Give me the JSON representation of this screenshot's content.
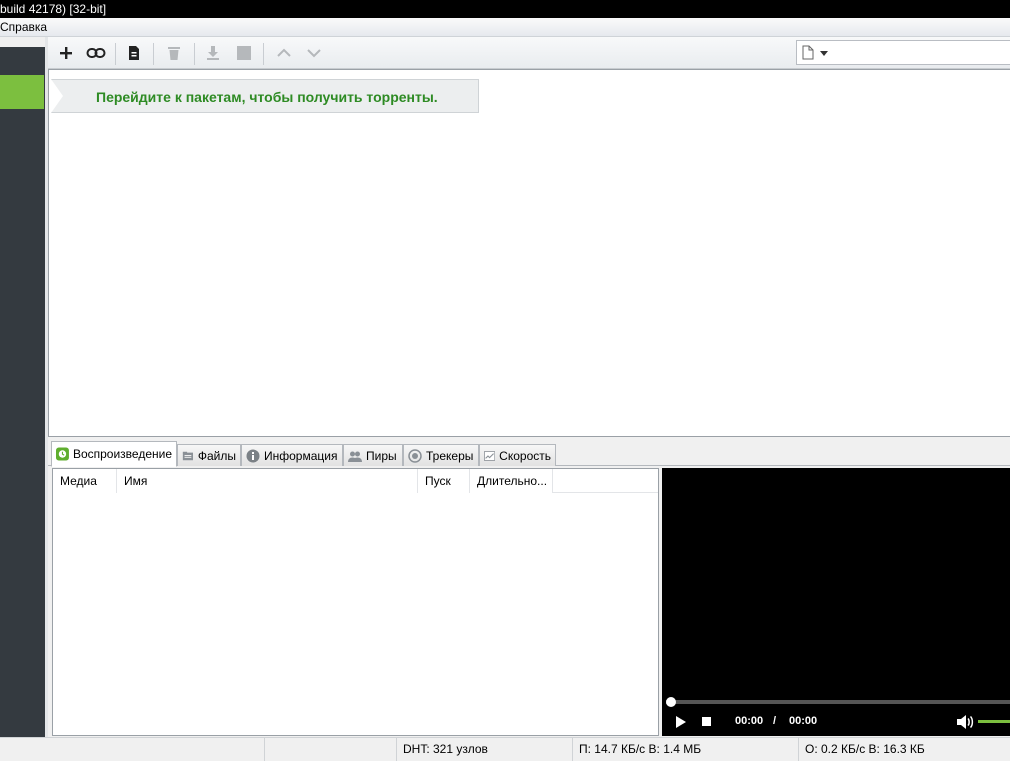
{
  "window": {
    "title": "build 42178) [32-bit]"
  },
  "menu": {
    "help": "Справка"
  },
  "toolbar": {
    "buttons": [
      {
        "icon": "plus-icon"
      },
      {
        "icon": "link-icon"
      },
      {
        "icon": "create-torrent-icon"
      },
      {
        "icon": "trash-icon"
      },
      {
        "icon": "download-icon"
      },
      {
        "icon": "stop-icon"
      },
      {
        "icon": "chevron-up-icon"
      },
      {
        "icon": "chevron-down-icon"
      }
    ]
  },
  "banner": {
    "text": "Перейдите к пакетам, чтобы получить торренты."
  },
  "tabs": [
    {
      "label": "Воспроизведение",
      "icon": "playback-icon",
      "active": true
    },
    {
      "label": "Файлы",
      "icon": "files-icon"
    },
    {
      "label": "Информация",
      "icon": "info-icon"
    },
    {
      "label": "Пиры",
      "icon": "peers-icon"
    },
    {
      "label": "Трекеры",
      "icon": "trackers-icon"
    },
    {
      "label": "Скорость",
      "icon": "speed-icon"
    }
  ],
  "columns": [
    "Медиа",
    "Имя",
    "Пуск",
    "Длительно..."
  ],
  "player": {
    "current": "00:00",
    "separator": "/",
    "total": "00:00"
  },
  "status": {
    "dht": "DHT: 321 узлов",
    "download": "П: 14.7 КБ/с В: 1.4 МБ",
    "upload": "О: 0.2 КБ/с В: 16.3 КБ"
  },
  "colors": {
    "accent": "#7cbf3f",
    "banner_text": "#2e8b24",
    "sidebar": "#343a40"
  }
}
